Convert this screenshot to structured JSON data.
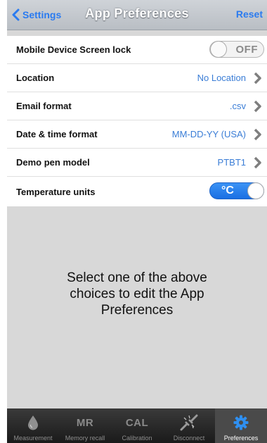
{
  "nav": {
    "back_label": "Settings",
    "title": "App Preferences",
    "action_label": "Reset"
  },
  "settings": [
    {
      "label": "Mobile Device Screen lock",
      "toggle_text": "OFF",
      "state": "off"
    },
    {
      "label": "Location",
      "value": "No Location"
    },
    {
      "label": "Email format",
      "value": ".csv"
    },
    {
      "label": "Date & time format",
      "value": "MM-DD-YY (USA)"
    },
    {
      "label": "Demo pen model",
      "value": "PTBT1"
    },
    {
      "label": "Temperature units",
      "toggle_text": "°C",
      "state": "on"
    }
  ],
  "message": [
    "Select one of the above",
    "choices to edit the App",
    "Preferences"
  ],
  "tabs": [
    {
      "label": "Measurement",
      "icon": "drop-icon"
    },
    {
      "label": "Memory recall",
      "icon_text": "MR"
    },
    {
      "label": "Calibration",
      "icon_text": "CAL"
    },
    {
      "label": "Disconnect",
      "icon": "disconnect-icon"
    },
    {
      "label": "Preferences",
      "icon": "gear-icon",
      "active": true
    }
  ],
  "colors": {
    "accent": "#2a7bf0",
    "value_text": "#3a7dd6",
    "toggle_on": "#1a6fe3",
    "gear": "#2f8ff0",
    "background": "#d8d8d8",
    "tabbar": "#1a1a1a"
  }
}
